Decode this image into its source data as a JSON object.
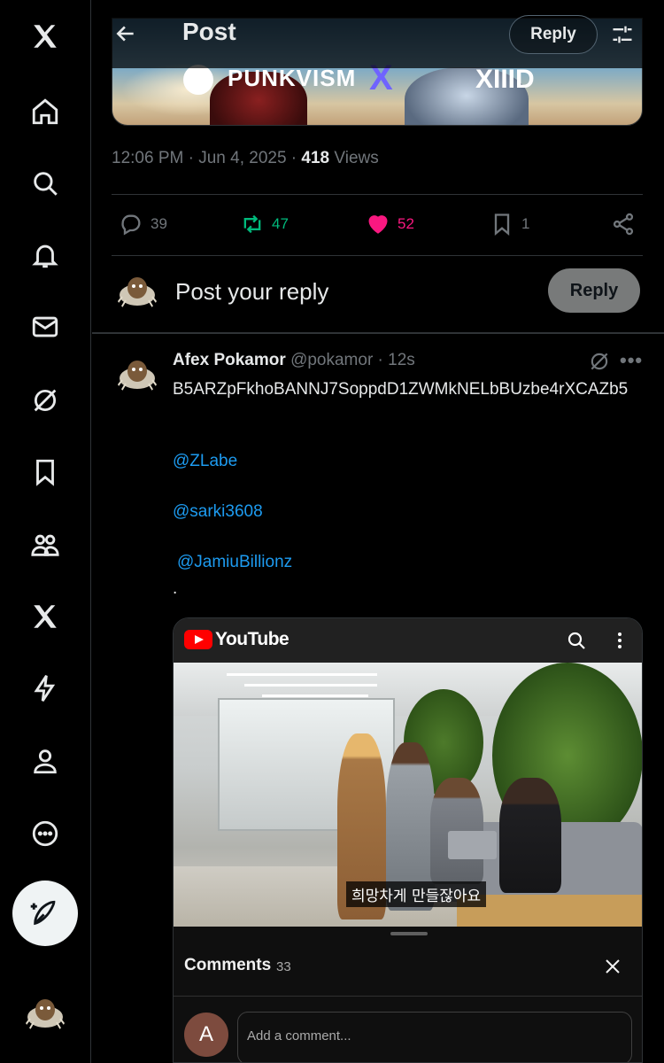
{
  "nav": {
    "items": [
      "x-logo",
      "home",
      "explore",
      "notifications",
      "messages",
      "grok",
      "bookmarks",
      "communities",
      "premium",
      "verified-orgs",
      "profile",
      "more"
    ]
  },
  "header": {
    "title": "Post",
    "reply_label": "Reply"
  },
  "banner": {
    "brand_left": "PUNKVISM",
    "brand_cross": "X",
    "brand_right": "XIIID"
  },
  "post_meta": {
    "time": "12:06 PM",
    "sep1": " · ",
    "date": "Jun 4, 2025",
    "sep2": " · ",
    "views_count": "418",
    "views_label": " Views"
  },
  "actions": {
    "replies": "39",
    "reposts": "47",
    "likes": "52",
    "bookmarks": "1"
  },
  "composer": {
    "placeholder": "Post your reply",
    "button": "Reply"
  },
  "reply": {
    "name": "Afex Pokamor",
    "handle": "@pokamor",
    "time": " · 12s",
    "text": "B5ARZpFkhoBANNJ7SoppdD1ZWMkNELbBUzbe4rXCAZb5",
    "mentions": [
      "@ZLabe",
      "@sarki3608",
      "@JamiuBillionz"
    ],
    "trailing": "."
  },
  "youtube": {
    "logo_text": "YouTube",
    "subtitle": "희망차게 만들잖아요",
    "comments_title": "Comments",
    "comments_count": "33",
    "avatar_letter": "A",
    "comment_placeholder": "Add a comment..."
  },
  "colors": {
    "like": "#f91880",
    "repost": "#00ba7c",
    "link": "#1d9bf0",
    "muted": "#71767b"
  }
}
